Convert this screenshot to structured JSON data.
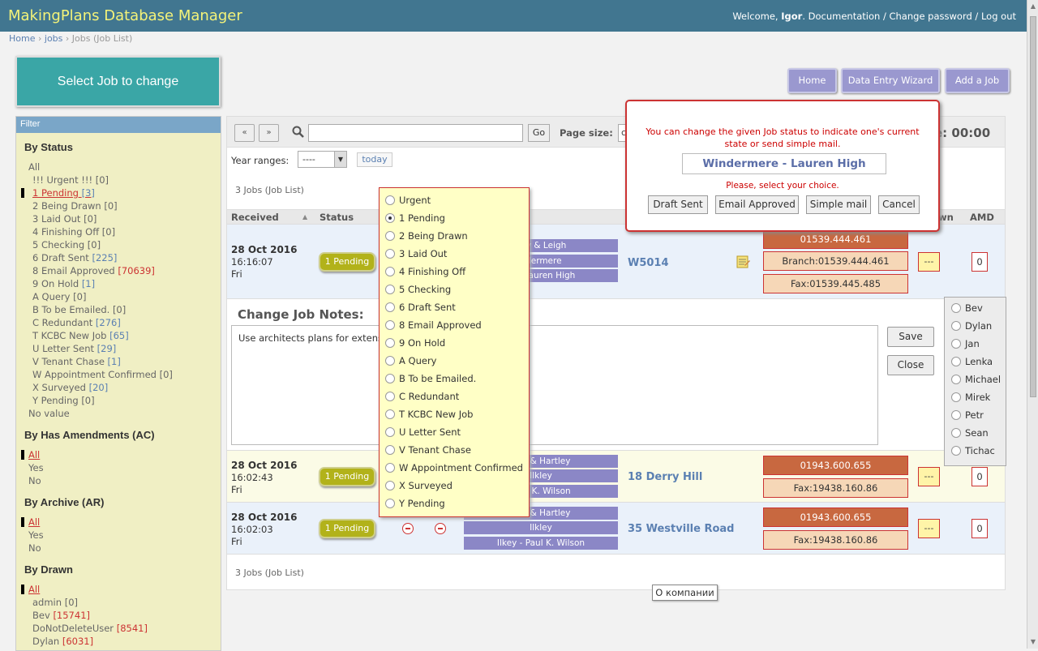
{
  "app_title": "MakingPlans Database Manager",
  "header": {
    "welcome": "Welcome,",
    "user": "Igor",
    "links": ". Documentation / Change password / Log out"
  },
  "breadcrumb": {
    "home": "Home",
    "jobs": "jobs",
    "current": "Jobs (Job List)"
  },
  "select_title": "Select Job to change",
  "actions": {
    "home": "Home",
    "wizard": "Data Entry Wizard",
    "add": "Add a Job"
  },
  "filter": {
    "title": "Filter",
    "by_status": {
      "title": "By Status",
      "items": [
        {
          "label": "All",
          "count": ""
        },
        {
          "label": "!!! Urgent !!!",
          "count": "[0]"
        },
        {
          "label": "1 Pending",
          "count": "[3]"
        },
        {
          "label": "2 Being Drawn",
          "count": "[0]"
        },
        {
          "label": "3 Laid Out",
          "count": "[0]"
        },
        {
          "label": "4 Finishing Off",
          "count": "[0]"
        },
        {
          "label": "5 Checking",
          "count": "[0]"
        },
        {
          "label": "6 Draft Sent",
          "count": "[225]"
        },
        {
          "label": "8 Email Approved",
          "count": "[70639]"
        },
        {
          "label": "9 On Hold",
          "count": "[1]"
        },
        {
          "label": "A Query",
          "count": "[0]"
        },
        {
          "label": "B To be Emailed.",
          "count": "[0]"
        },
        {
          "label": "C Redundant",
          "count": "[276]"
        },
        {
          "label": "T KCBC New Job",
          "count": "[65]"
        },
        {
          "label": "U Letter Sent",
          "count": "[29]"
        },
        {
          "label": "V Tenant Chase",
          "count": "[1]"
        },
        {
          "label": "W Appointment Confirmed",
          "count": "[0]"
        },
        {
          "label": "X Surveyed",
          "count": "[20]"
        },
        {
          "label": "Y Pending",
          "count": "[0]"
        },
        {
          "label": "No value",
          "count": ""
        }
      ]
    },
    "by_amendments": {
      "title": "By Has Amendments (AC)",
      "items": [
        "All",
        "Yes",
        "No"
      ]
    },
    "by_archive": {
      "title": "By Archive (AR)",
      "items": [
        "All",
        "Yes",
        "No"
      ]
    },
    "by_drawn": {
      "title": "By Drawn",
      "items": [
        {
          "label": "All",
          "count": ""
        },
        {
          "label": "admin",
          "count": "[0]"
        },
        {
          "label": "Bev",
          "count": "[15741]"
        },
        {
          "label": "DoNotDeleteUser",
          "count": "[8541]"
        },
        {
          "label": "Dylan",
          "count": "[6031]"
        }
      ]
    }
  },
  "toolbar": {
    "prev": "«",
    "next": "»",
    "search_value": "",
    "go": "Go",
    "page_size_label": "Page size:",
    "page_size_value": "c",
    "time": "e: 00:00",
    "year_label": "Year ranges:",
    "year_value": "----",
    "today": "today"
  },
  "job_count": "3 Jobs (Job List)",
  "columns": {
    "received": "Received",
    "status": "Status",
    "drawn": "wn",
    "amd": "AMD"
  },
  "rows": [
    {
      "date": "28 Oct 2016",
      "time": "16:16:07",
      "day": "Fri",
      "status": "1 Pending",
      "tags": [
        "ney & Leigh",
        "ndermere",
        "re - Lauren High"
      ],
      "address": "W5014",
      "phones": [
        "01539.444.461",
        "Branch:01539.444.461",
        "Fax:01539.445.485"
      ],
      "drawn": "---",
      "amd": "0"
    },
    {
      "date": "28 Oct 2016",
      "time": "16:02:43",
      "day": "Fri",
      "status": "1 Pending",
      "tags": [
        "Son & Hartley",
        "Ilkley",
        "Paul K. Wilson"
      ],
      "address": "18 Derry Hill",
      "phones": [
        "01943.600.655",
        "Fax:19438.160.86"
      ],
      "drawn": "---",
      "amd": "0"
    },
    {
      "date": "28 Oct 2016",
      "time": "16:02:03",
      "day": "Fri",
      "status": "1 Pending",
      "tags": [
        "Son & Hartley",
        "Ilkley",
        "Ilkey - Paul K. Wilson"
      ],
      "address": "35 Westville Road",
      "phones": [
        "01943.600.655",
        "Fax:19438.160.86"
      ],
      "drawn": "---",
      "amd": "0"
    }
  ],
  "notes": {
    "title": "Change Job Notes:",
    "text": "Use architects plans for extens",
    "save": "Save",
    "close": "Close"
  },
  "status_options": [
    "Urgent",
    "1 Pending",
    "2 Being Drawn",
    "3 Laid Out",
    "4 Finishing Off",
    "5 Checking",
    "6 Draft Sent",
    "8 Email Approved",
    "9 On Hold",
    "A Query",
    "B To be Emailed.",
    "C Redundant",
    "T KCBC New Job",
    "U Letter Sent",
    "V Tenant Chase",
    "W Appointment Confirmed",
    "X Surveyed",
    "Y Pending"
  ],
  "status_selected": "1 Pending",
  "dialog": {
    "message": "You can change the given Job status to indicate one's current state or send simple mail.",
    "name": "Windermere - Lauren High",
    "sub": "Please, select your choice.",
    "draft": "Draft Sent",
    "approved": "Email Approved",
    "mail": "Simple mail",
    "cancel": "Cancel"
  },
  "drawn_options": [
    "Bev",
    "Dylan",
    "Jan",
    "Lenka",
    "Michael",
    "Mirek",
    "Petr",
    "Sean",
    "Tichac"
  ],
  "tooltip": "О компании",
  "colors": {
    "header": "#417690",
    "brand": "#f4f379",
    "pending": "#b2b21a",
    "tag": "#8b87c6",
    "phone_dark": "#c86840",
    "accent_red": "#cc3333"
  }
}
